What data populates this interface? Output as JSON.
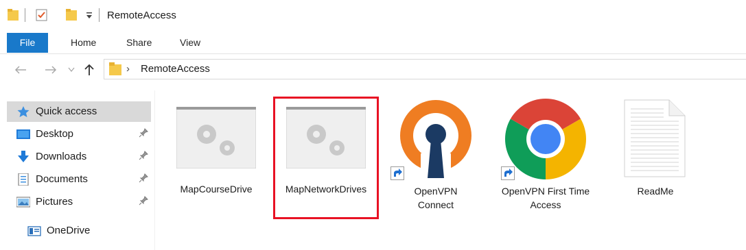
{
  "window": {
    "title": "RemoteAccess"
  },
  "ribbon": {
    "tabs": [
      {
        "label": "File"
      },
      {
        "label": "Home"
      },
      {
        "label": "Share"
      },
      {
        "label": "View"
      }
    ]
  },
  "address_bar": {
    "path": "RemoteAccess"
  },
  "nav_pane": {
    "quick_access": "Quick access",
    "items": [
      {
        "label": "Desktop",
        "pinned": true
      },
      {
        "label": "Downloads",
        "pinned": true
      },
      {
        "label": "Documents",
        "pinned": true
      },
      {
        "label": "Pictures",
        "pinned": true
      }
    ],
    "onedrive": "OneDrive"
  },
  "files": [
    {
      "name": "MapCourseDrive",
      "icon": "application-icon"
    },
    {
      "name": "MapNetworkDrives",
      "icon": "application-icon",
      "highlighted": true
    },
    {
      "name": "OpenVPN Connect",
      "icon": "openvpn-icon",
      "shortcut": true
    },
    {
      "name": "OpenVPN First Time Access",
      "icon": "chrome-icon",
      "shortcut": true
    },
    {
      "name": "ReadMe",
      "icon": "text-document-icon"
    }
  ],
  "colors": {
    "accent": "#1979ca",
    "highlight": "#e81123",
    "selection": "#d9d9d9"
  }
}
